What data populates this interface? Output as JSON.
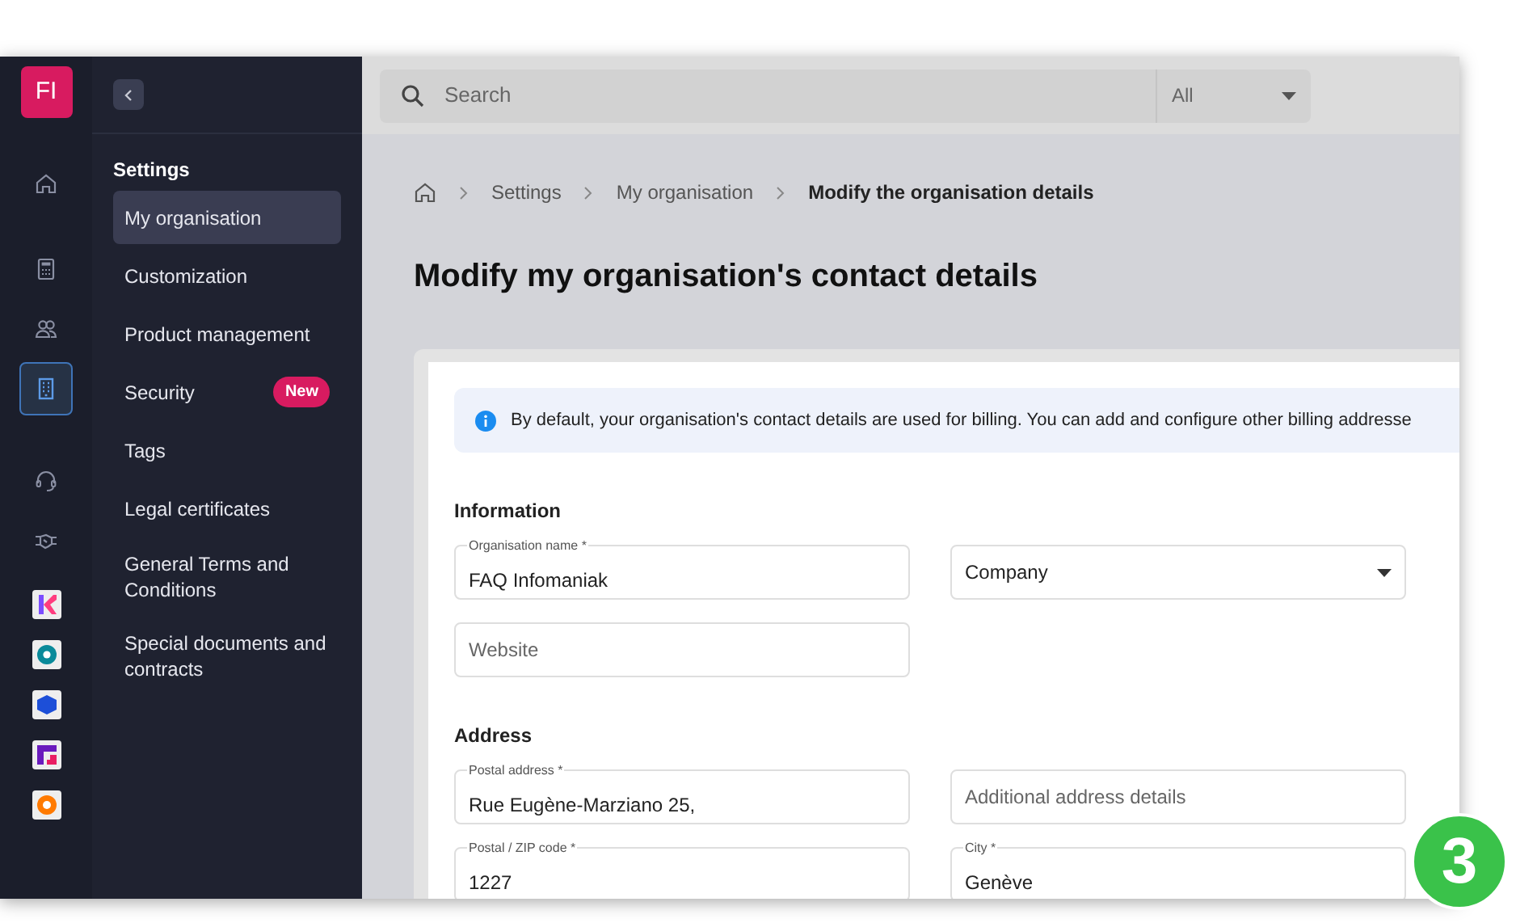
{
  "account_badge": "FI",
  "rail": [
    {
      "selected": false
    },
    {
      "selected": false
    },
    {
      "selected": false
    },
    {
      "selected": true
    },
    {
      "selected": false
    },
    {
      "selected": false
    }
  ],
  "sidebar": {
    "title": "Settings",
    "items": [
      {
        "label": "My organisation",
        "selected": true
      },
      {
        "label": "Customization",
        "selected": false
      },
      {
        "label": "Product management",
        "selected": false
      },
      {
        "label": "Security",
        "selected": false,
        "badge": "New"
      },
      {
        "label": "Tags",
        "selected": false
      },
      {
        "label": "Legal certificates",
        "selected": false
      },
      {
        "label": "General Terms and Conditions",
        "selected": false
      },
      {
        "label": "Special documents and contracts",
        "selected": false
      }
    ]
  },
  "search": {
    "placeholder": "Search",
    "scope": "All"
  },
  "breadcrumb": [
    "Settings",
    "My organisation",
    "Modify the organisation details"
  ],
  "heading": "Modify my organisation's contact details",
  "info": "By default, your organisation's contact details are used for billing. You can add and configure other billing addresse",
  "sections": [
    {
      "title": "Information",
      "rows": [
        [
          {
            "kind": "text",
            "label": "Organisation name *",
            "value": "FAQ Infomaniak"
          },
          {
            "kind": "select",
            "value": "Company"
          }
        ],
        [
          {
            "kind": "text",
            "placeholder": "Website"
          }
        ]
      ]
    },
    {
      "title": "Address",
      "rows": [
        [
          {
            "kind": "text",
            "label": "Postal address *",
            "value": "Rue Eugène-Marziano 25,"
          },
          {
            "kind": "text",
            "placeholder": "Additional address details"
          }
        ],
        [
          {
            "kind": "text",
            "label": "Postal / ZIP code *",
            "value": "1227"
          },
          {
            "kind": "text",
            "label": "City *",
            "value": "Genève"
          }
        ]
      ]
    }
  ],
  "step_badge": "3"
}
